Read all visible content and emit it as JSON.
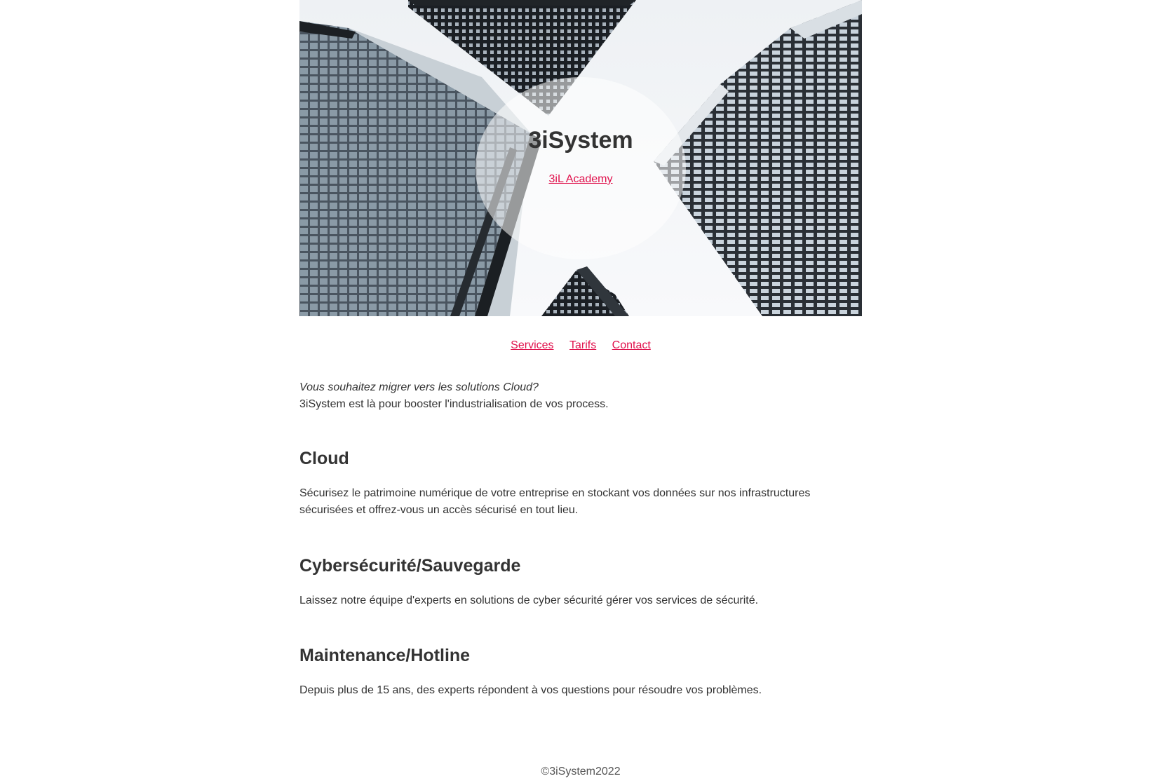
{
  "hero": {
    "title": "3iSystem",
    "academy_link": "3iL Academy"
  },
  "nav": {
    "items": [
      "Services",
      "Tarifs",
      "Contact"
    ]
  },
  "intro": {
    "question": "Vous souhaitez migrer vers les solutions Cloud?",
    "text": "3iSystem est là pour booster l'industrialisation de vos process."
  },
  "sections": [
    {
      "title": "Cloud",
      "text": "Sécurisez le patrimoine numérique de votre entreprise en stockant vos données sur nos infrastructures sécurisées et offrez-vous un accès sécurisé en tout lieu."
    },
    {
      "title": "Cybersécurité/Sauvegarde",
      "text": "Laissez notre équipe d'experts en solutions de cyber sécurité gérer vos services de sécurité."
    },
    {
      "title": "Maintenance/Hotline",
      "text": "Depuis plus de 15 ans, des experts répondent à vos questions pour résoudre vos problèmes."
    }
  ],
  "footer": {
    "copyright": "©3iSystem2022"
  },
  "colors": {
    "link": "#e0114c",
    "text": "#333333",
    "background": "#ffffff"
  }
}
